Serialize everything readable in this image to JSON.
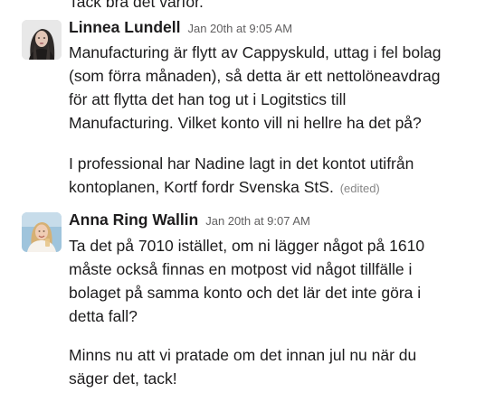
{
  "previous_message": {
    "fragment": "Tack bra det varför."
  },
  "messages": [
    {
      "author": "Linnea Lundell",
      "timestamp": "Jan 20th at 9:05 AM",
      "paragraphs": [
        {
          "lines": [
            "Manufacturing är flytt av Cappyskuld, uttag i fel bolag",
            "(som förra månaden), så detta är ett nettolöneavdrag",
            "för att flytta det han tog ut i Logitstics till",
            "Manufacturing. Vilket konto vill ni hellre ha det på?"
          ]
        },
        {
          "lines": [
            "I professional har Nadine lagt in det kontot utifrån",
            "kontoplanen, Kortf fordr Svenska StS."
          ],
          "edited": "(edited)"
        }
      ]
    },
    {
      "author": "Anna Ring Wallin",
      "timestamp": "Jan 20th at 9:07 AM",
      "paragraphs": [
        {
          "lines": [
            "Ta det på 7010 istället, om ni lägger något på 1610",
            "måste också finnas en motpost vid något tillfälle i",
            "bolaget på samma konto och det lär det inte göra i",
            "detta fall?"
          ]
        },
        {
          "lines": [
            "Minns nu att vi pratade om det innan jul nu när du",
            "säger det, tack!"
          ]
        }
      ]
    }
  ]
}
